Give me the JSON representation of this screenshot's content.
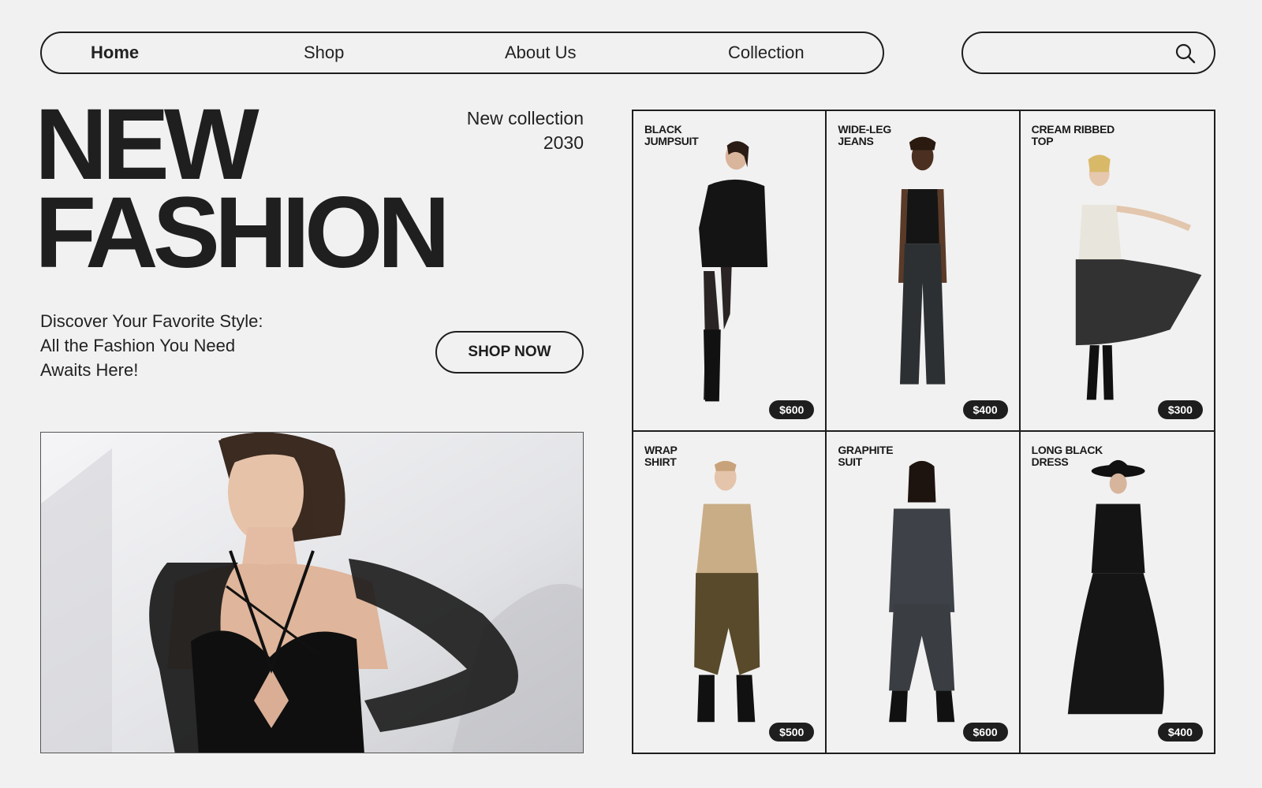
{
  "nav": {
    "items": [
      {
        "label": "Home",
        "active": true
      },
      {
        "label": "Shop",
        "active": false
      },
      {
        "label": "About Us",
        "active": false
      },
      {
        "label": "Collection",
        "active": false
      }
    ]
  },
  "search": {
    "value": "",
    "placeholder": "",
    "icon": "search-icon"
  },
  "hero": {
    "title_line1": "NEW",
    "title_line2": "FASHION",
    "collection_line1": "New collection",
    "collection_line2": "2030",
    "tagline_line1": "Discover Your Favorite Style:",
    "tagline_line2": "All the Fashion You Need",
    "tagline_line3": "Awaits Here!",
    "cta_label": "SHOP NOW"
  },
  "products": [
    {
      "name": "BLACK\nJUMPSUIT",
      "price": "$600"
    },
    {
      "name": "WIDE-LEG\nJEANS",
      "price": "$400"
    },
    {
      "name": "CREAM RIBBED\nTOP",
      "price": "$300"
    },
    {
      "name": "WRAP\nSHIRT",
      "price": "$500"
    },
    {
      "name": "GRAPHITE\nSUIT",
      "price": "$600"
    },
    {
      "name": "LONG BLACK\nDRESS",
      "price": "$400"
    }
  ],
  "colors": {
    "background": "#f2f1f1",
    "ink": "#1e1e1e",
    "price_badge": "#1e1e1e",
    "price_text": "#ffffff"
  }
}
